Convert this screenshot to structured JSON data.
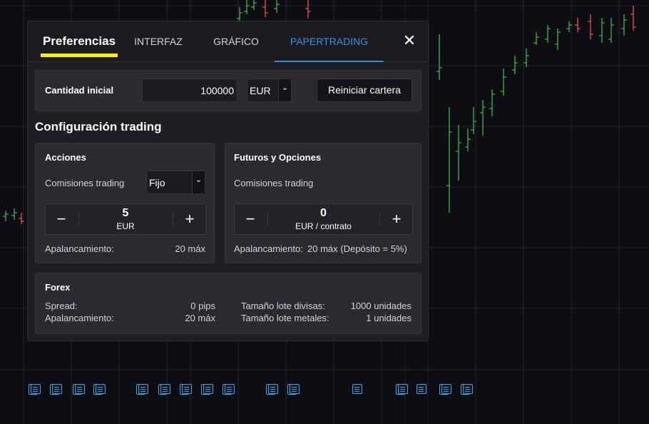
{
  "tabs": [
    {
      "label": "Preferencias"
    },
    {
      "label": "INTERFAZ"
    },
    {
      "label": "GRÁFICO"
    },
    {
      "label": "PAPERTRADING"
    }
  ],
  "close_symbol": "✕",
  "initial": {
    "label": "Cantidad inicial",
    "amount": "100000",
    "currency": "EUR",
    "reset_label": "Reiniciar cartera"
  },
  "section_title": "Configuración trading",
  "stocks": {
    "title": "Acciones",
    "commission_label": "Comisiones trading",
    "commission_type": "Fijo",
    "commission_value": "5",
    "commission_unit": "EUR",
    "leverage_label": "Apalancamiento:",
    "leverage_value": "20 máx"
  },
  "futures": {
    "title": "Futuros y Opciones",
    "commission_label": "Comisiones trading",
    "commission_value": "0",
    "commission_unit": "EUR / contrato",
    "leverage_label": "Apalancamiento:",
    "leverage_value": "20 máx (Depósito = 5%)"
  },
  "forex": {
    "title": "Forex",
    "spread_label": "Spread:",
    "spread_value": "0 pips",
    "leverage_label": "Apalancamiento:",
    "leverage_value": "20 máx",
    "lot_fx_label": "Tamaño lote divisas:",
    "lot_fx_value": "1000 unidades",
    "lot_metal_label": "Tamaño lote metales:",
    "lot_metal_value": "1 unidades"
  },
  "colors": {
    "accent": "#3b8ee6",
    "highlight": "#fff200",
    "candle_up": "#4caf50",
    "candle_down": "#e05656",
    "news": "#4aa3df"
  },
  "icons": {
    "minus": "−",
    "plus": "+",
    "chevron": "⌄"
  }
}
